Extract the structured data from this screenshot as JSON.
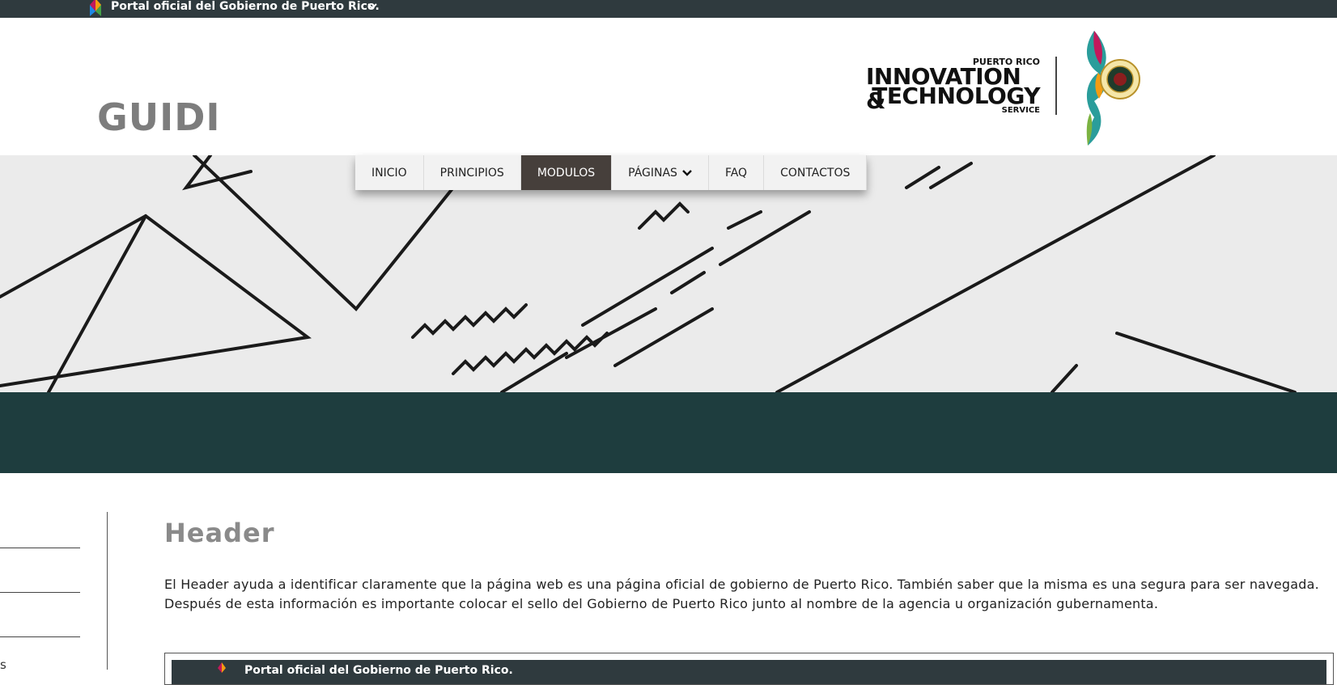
{
  "gov_banner": {
    "text": "Portal oficial del Gobierno de Puerto Rico."
  },
  "header": {
    "site_title": "GUIDI",
    "logo": {
      "line_small": "PUERTO RICO",
      "line_big_1": "INNOVATION &",
      "line_big_2": "TECHNOLOGY",
      "line_service": "SERVICE"
    }
  },
  "nav": {
    "items": [
      {
        "label": "INICIO",
        "active": false
      },
      {
        "label": "PRINCIPIOS",
        "active": false
      },
      {
        "label": "MODULOS",
        "active": true
      },
      {
        "label": "PÁGINAS",
        "active": false,
        "has_dropdown": true
      },
      {
        "label": "FAQ",
        "active": false
      },
      {
        "label": "CONTACTOS",
        "active": false
      }
    ]
  },
  "sidebar": {
    "fragment": "s"
  },
  "content": {
    "title": "Header",
    "paragraph": "El Header ayuda a identificar claramente que la página web es una página oficial de gobierno de Puerto Rico. También saber que la misma es una segura para ser navegada. Después de esta información es importante colocar el sello del Gobierno de Puerto Rico junto al nombre de la agencia u organización gubernamenta.",
    "example_bar_text": "Portal oficial del Gobierno de Puerto Rico."
  },
  "colors": {
    "gov_bar": "#2f3a3e",
    "teal_band": "#1e3d3e",
    "nav_active": "#463f3b",
    "title_gray": "#7d7d7d"
  }
}
